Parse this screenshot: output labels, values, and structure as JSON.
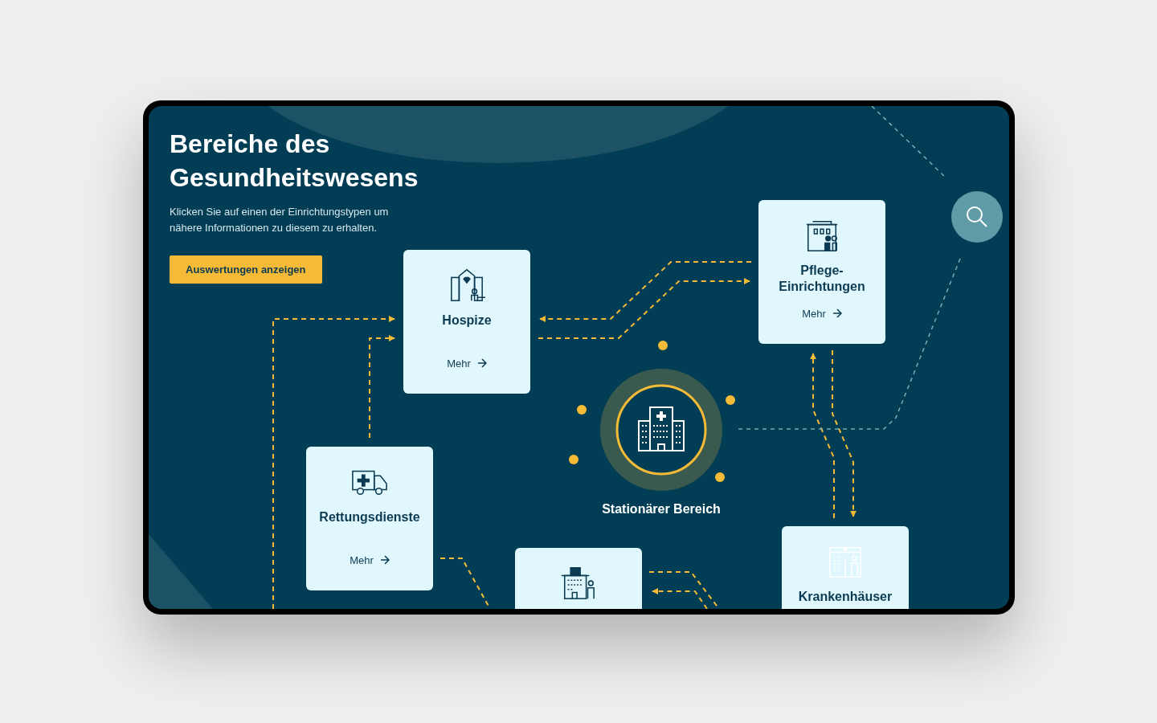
{
  "page": {
    "title": "Bereiche des Gesundheitswesens",
    "description": "Klicken Sie auf einen der Einrichtungstypen um nähere Informationen zu diesem zu erhalten.",
    "button": "Auswertungen anzeigen"
  },
  "cards": [
    {
      "kind": "hospice",
      "title": "Hospize",
      "link": "Mehr",
      "dimmed": false
    },
    {
      "kind": "care",
      "title": "Pflege-Einrichtungen",
      "link": "Mehr",
      "dimmed": false
    },
    {
      "kind": "ambulance",
      "title": "Rettungsdienste",
      "link": "Mehr",
      "dimmed": false
    },
    {
      "kind": "clinic",
      "dimmed": false
    },
    {
      "kind": "hospital",
      "title": "Krankenhäuser",
      "dimmed": true
    }
  ],
  "center": {
    "label": "Stationärer Bereich"
  }
}
